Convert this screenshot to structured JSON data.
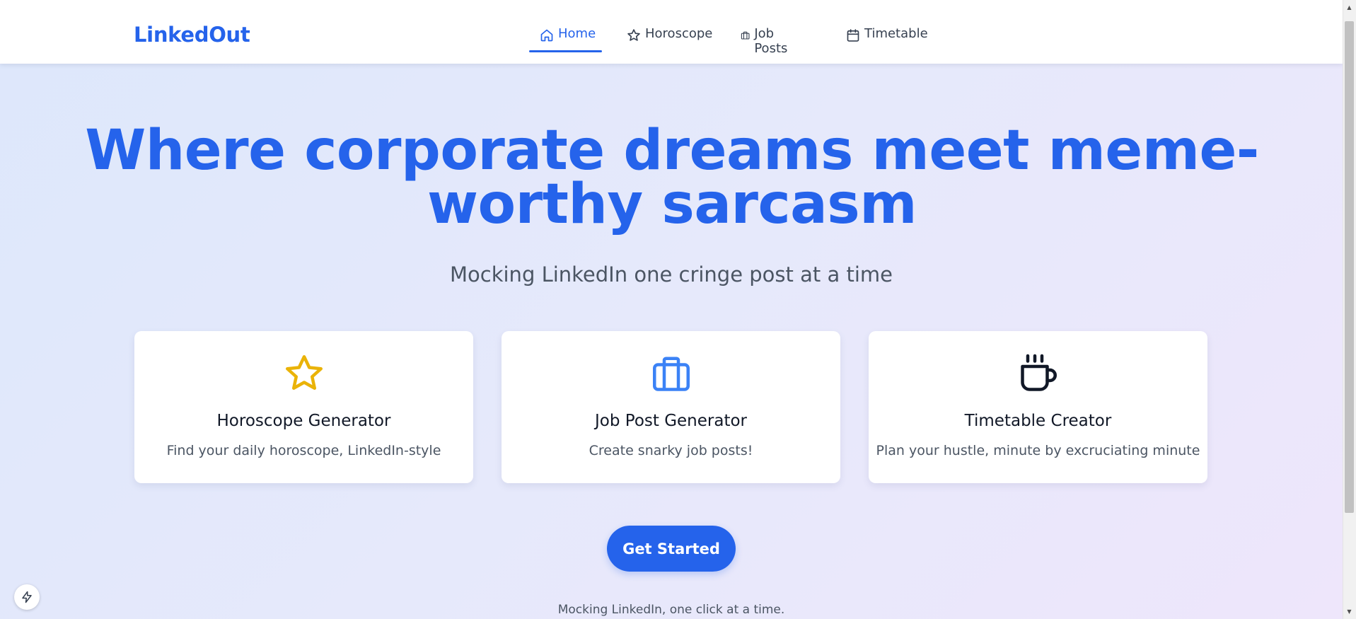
{
  "brand": {
    "name": "LinkedOut"
  },
  "nav": {
    "items": [
      {
        "label": "Home",
        "icon": "home-icon",
        "active": true
      },
      {
        "label": "Horoscope",
        "icon": "star-icon",
        "active": false
      },
      {
        "label": "Job Posts",
        "icon": "briefcase-icon",
        "active": false
      },
      {
        "label": "Timetable",
        "icon": "calendar-icon",
        "active": false
      }
    ]
  },
  "hero": {
    "title": "Where corporate dreams meet meme-worthy sarcasm",
    "subtitle": "Mocking LinkedIn one cringe post at a time"
  },
  "cards": [
    {
      "title": "Horoscope Generator",
      "description": "Find your daily horoscope, LinkedIn-style",
      "icon": "star-icon",
      "color": "#eab308"
    },
    {
      "title": "Job Post Generator",
      "description": "Create snarky job posts!",
      "icon": "briefcase-icon",
      "color": "#3b82f6"
    },
    {
      "title": "Timetable Creator",
      "description": "Plan your hustle, minute by excruciating minute",
      "icon": "coffee-icon",
      "color": "#111827"
    }
  ],
  "cta": {
    "label": "Get Started"
  },
  "footer": {
    "note": "Mocking LinkedIn, one click at a time."
  },
  "colors": {
    "accent": "#2563eb",
    "text": "#111827",
    "muted": "#4b5563"
  }
}
